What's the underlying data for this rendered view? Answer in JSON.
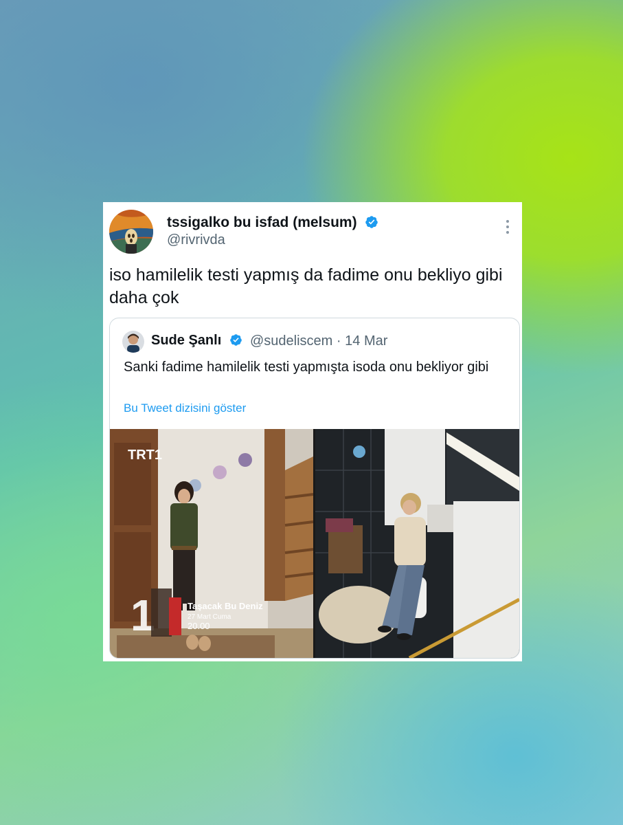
{
  "tweet": {
    "author_name": "tssigalko bu isfad (melsum)",
    "author_handle": "@rivrivda",
    "text": "iso hamilelik testi yapmış da fadime onu bekliyo gibi daha çok",
    "colors": {
      "verified": "#1d9bf0",
      "link": "#1d9bf0",
      "handle": "#536471"
    }
  },
  "quoted_tweet": {
    "author_name": "Sude Şanlı",
    "author_handle": "@sudeliscem",
    "separator": "·",
    "date": "14 Mar",
    "text": "Sanki fadime hamilelik testi yapmışta isoda onu bekliyor gibi",
    "show_thread_label": "Bu Tweet dizisini göster"
  },
  "media": {
    "channel_logo": "TRT1",
    "show_title": "Taşacak Bu Deniz",
    "air_date": "27 Mart Cuma",
    "air_time": "20.00"
  },
  "icons": {
    "verified": "verified-badge-icon",
    "more": "more-options-icon"
  }
}
